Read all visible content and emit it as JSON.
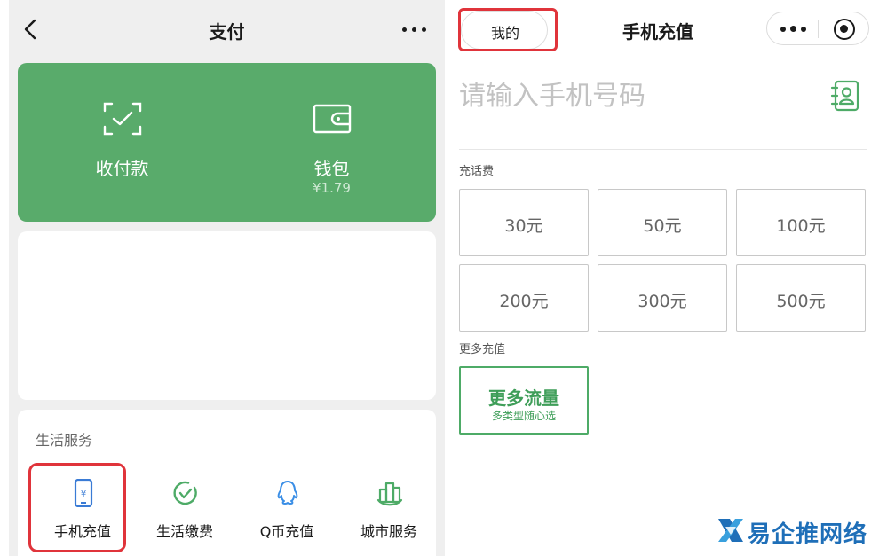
{
  "left": {
    "nav": {
      "title": "支付"
    },
    "green_card": {
      "items": [
        {
          "label": "收付款",
          "sub": "",
          "icon": "scan-pay-icon"
        },
        {
          "label": "钱包",
          "sub": "¥1.79",
          "icon": "wallet-icon"
        }
      ]
    },
    "services": {
      "title": "生活服务",
      "items": [
        {
          "label": "手机充值",
          "icon": "phone-recharge-icon",
          "highlighted": true
        },
        {
          "label": "生活缴费",
          "icon": "bill-payment-icon",
          "highlighted": false
        },
        {
          "label": "Q币充值",
          "icon": "qq-coin-icon",
          "highlighted": false
        },
        {
          "label": "城市服务",
          "icon": "city-service-icon",
          "highlighted": false
        }
      ]
    }
  },
  "right": {
    "mine_label": "我的",
    "title": "手机充值",
    "phone_placeholder": "请输入手机号码",
    "recharge_section_label": "充话费",
    "amounts": [
      "30元",
      "50元",
      "100元",
      "200元",
      "300元",
      "500元"
    ],
    "more_section_label": "更多充值",
    "flow": {
      "title": "更多流量",
      "subtitle": "多类型随心选"
    }
  },
  "watermark": {
    "text": "易企推网络"
  },
  "colors": {
    "wechat_green": "#59ab6b",
    "accent_green": "#3f9e59",
    "highlight_red": "#e0343b",
    "watermark_blue": "#1f6fb8"
  }
}
